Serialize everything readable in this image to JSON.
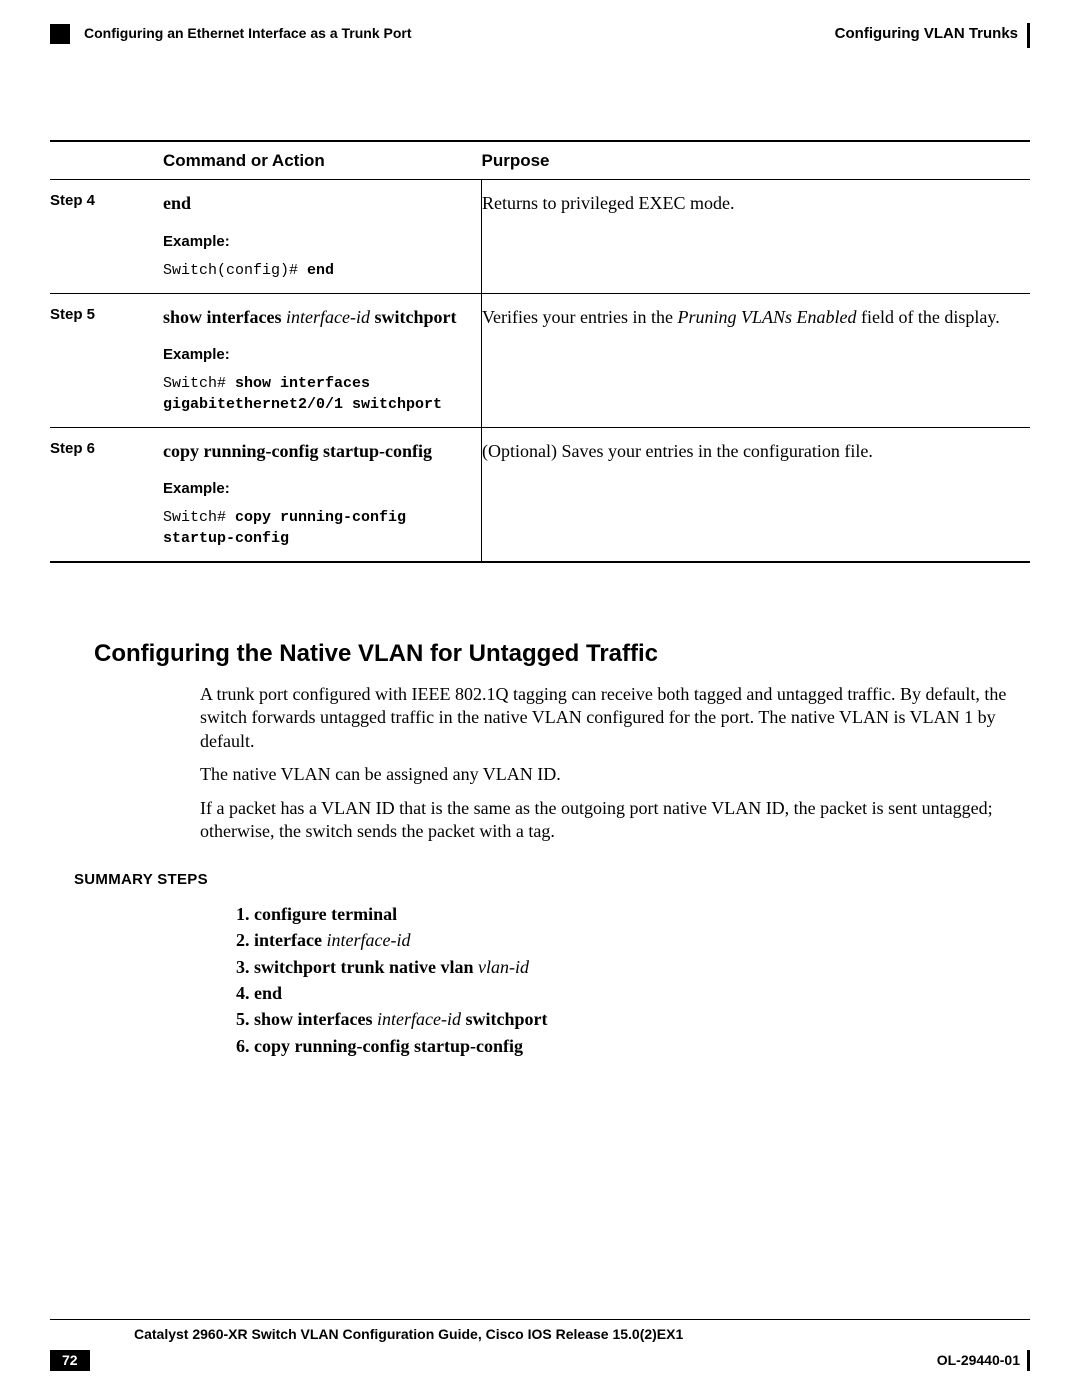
{
  "header": {
    "chapter": "Configuring VLAN Trunks",
    "subsection": "Configuring an Ethernet Interface as a Trunk Port"
  },
  "table": {
    "headers": {
      "step": "",
      "cmd": "Command or Action",
      "purpose": "Purpose"
    },
    "rows": [
      {
        "step": "Step 4",
        "cmd_bold1": "end",
        "cmd_italic": "",
        "cmd_bold2": "",
        "example_label": "Example:",
        "example_prefix": "Switch(config)# ",
        "example_bold": "end",
        "example_tail": "",
        "purpose_pre": "Returns to privileged EXEC mode.",
        "purpose_italic": "",
        "purpose_post": ""
      },
      {
        "step": "Step 5",
        "cmd_bold1": "show interfaces ",
        "cmd_italic": "interface-id",
        "cmd_bold2": " switchport",
        "example_label": "Example:",
        "example_prefix": "Switch# ",
        "example_bold": "show interfaces gigabitethernet2/0/1 switchport",
        "example_tail": "",
        "purpose_pre": "Verifies your entries in the ",
        "purpose_italic": "Pruning VLANs Enabled",
        "purpose_post": " field of the display."
      },
      {
        "step": "Step 6",
        "cmd_bold1": "copy running-config startup-config",
        "cmd_italic": "",
        "cmd_bold2": "",
        "example_label": "Example:",
        "example_prefix": "Switch# ",
        "example_bold": "copy running-config startup-config",
        "example_tail": "",
        "purpose_pre": "(Optional) Saves your entries in the configuration file.",
        "purpose_italic": "",
        "purpose_post": ""
      }
    ]
  },
  "section": {
    "title": "Configuring the Native VLAN for Untagged Traffic",
    "paras": [
      "A trunk port configured with IEEE 802.1Q tagging can receive both tagged and untagged traffic. By default, the switch forwards untagged traffic in the native VLAN configured for the port. The native VLAN is VLAN 1 by default.",
      "The native VLAN can be assigned any VLAN ID.",
      "If a packet has a VLAN ID that is the same as the outgoing port native VLAN ID, the packet is sent untagged; otherwise, the switch sends the packet with a tag."
    ],
    "summary_label": "SUMMARY STEPS",
    "summary": [
      {
        "bold1": "configure terminal",
        "italic": "",
        "bold2": ""
      },
      {
        "bold1": "interface ",
        "italic": "interface-id",
        "bold2": ""
      },
      {
        "bold1": "switchport trunk native vlan ",
        "italic": "vlan-id",
        "bold2": ""
      },
      {
        "bold1": "end",
        "italic": "",
        "bold2": ""
      },
      {
        "bold1": "show interfaces ",
        "italic": "interface-id",
        "bold2": " switchport"
      },
      {
        "bold1": "copy running-config startup-config",
        "italic": "",
        "bold2": ""
      }
    ]
  },
  "footer": {
    "title": "Catalyst 2960-XR Switch VLAN Configuration Guide, Cisco IOS Release 15.0(2)EX1",
    "page": "72",
    "docnum": "OL-29440-01"
  }
}
